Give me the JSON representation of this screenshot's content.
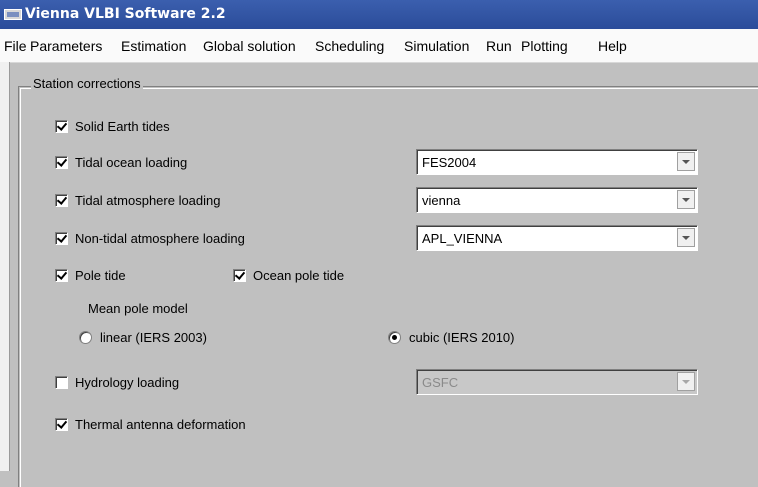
{
  "window": {
    "title": "Vienna VLBI Software 2.2"
  },
  "menu": [
    "File",
    "Parameters",
    "Estimation",
    "Global solution",
    "Scheduling",
    "Simulation",
    "Run",
    "Plotting",
    "Help"
  ],
  "group": {
    "title": "Station corrections"
  },
  "options": {
    "solid_earth_tides": {
      "label": "Solid Earth tides",
      "checked": true
    },
    "tidal_ocean_loading": {
      "label": "Tidal ocean loading",
      "checked": true,
      "model": "FES2004"
    },
    "tidal_atmosphere_loading": {
      "label": "Tidal atmosphere loading",
      "checked": true,
      "model": "vienna"
    },
    "nontidal_atmosphere_loading": {
      "label": "Non-tidal atmosphere loading",
      "checked": true,
      "model": "APL_VIENNA"
    },
    "pole_tide": {
      "label": "Pole tide",
      "checked": true
    },
    "ocean_pole_tide": {
      "label": "Ocean pole tide",
      "checked": true
    },
    "mean_pole_model": {
      "label": "Mean pole model",
      "linear": "linear (IERS 2003)",
      "cubic": "cubic (IERS 2010)",
      "selected": "cubic"
    },
    "hydrology_loading": {
      "label": "Hydrology loading",
      "checked": false,
      "model": "GSFC",
      "model_enabled": false
    },
    "thermal_antenna_deformation": {
      "label": "Thermal antenna deformation",
      "checked": true
    }
  }
}
